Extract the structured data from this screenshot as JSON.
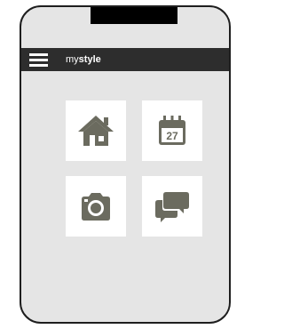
{
  "app": {
    "brand_light": "my",
    "brand_bold": "style"
  },
  "tiles": [
    {
      "icon": "home-icon"
    },
    {
      "icon": "calendar-icon",
      "date": "27"
    },
    {
      "icon": "camera-icon"
    },
    {
      "icon": "chat-icon"
    }
  ],
  "colors": {
    "frame": "#1e1e1e",
    "screen_background": "#e5e5e5",
    "app_bar": "#2d2d2d",
    "tile_background": "#ffffff",
    "icon": "#6b6b5f"
  }
}
